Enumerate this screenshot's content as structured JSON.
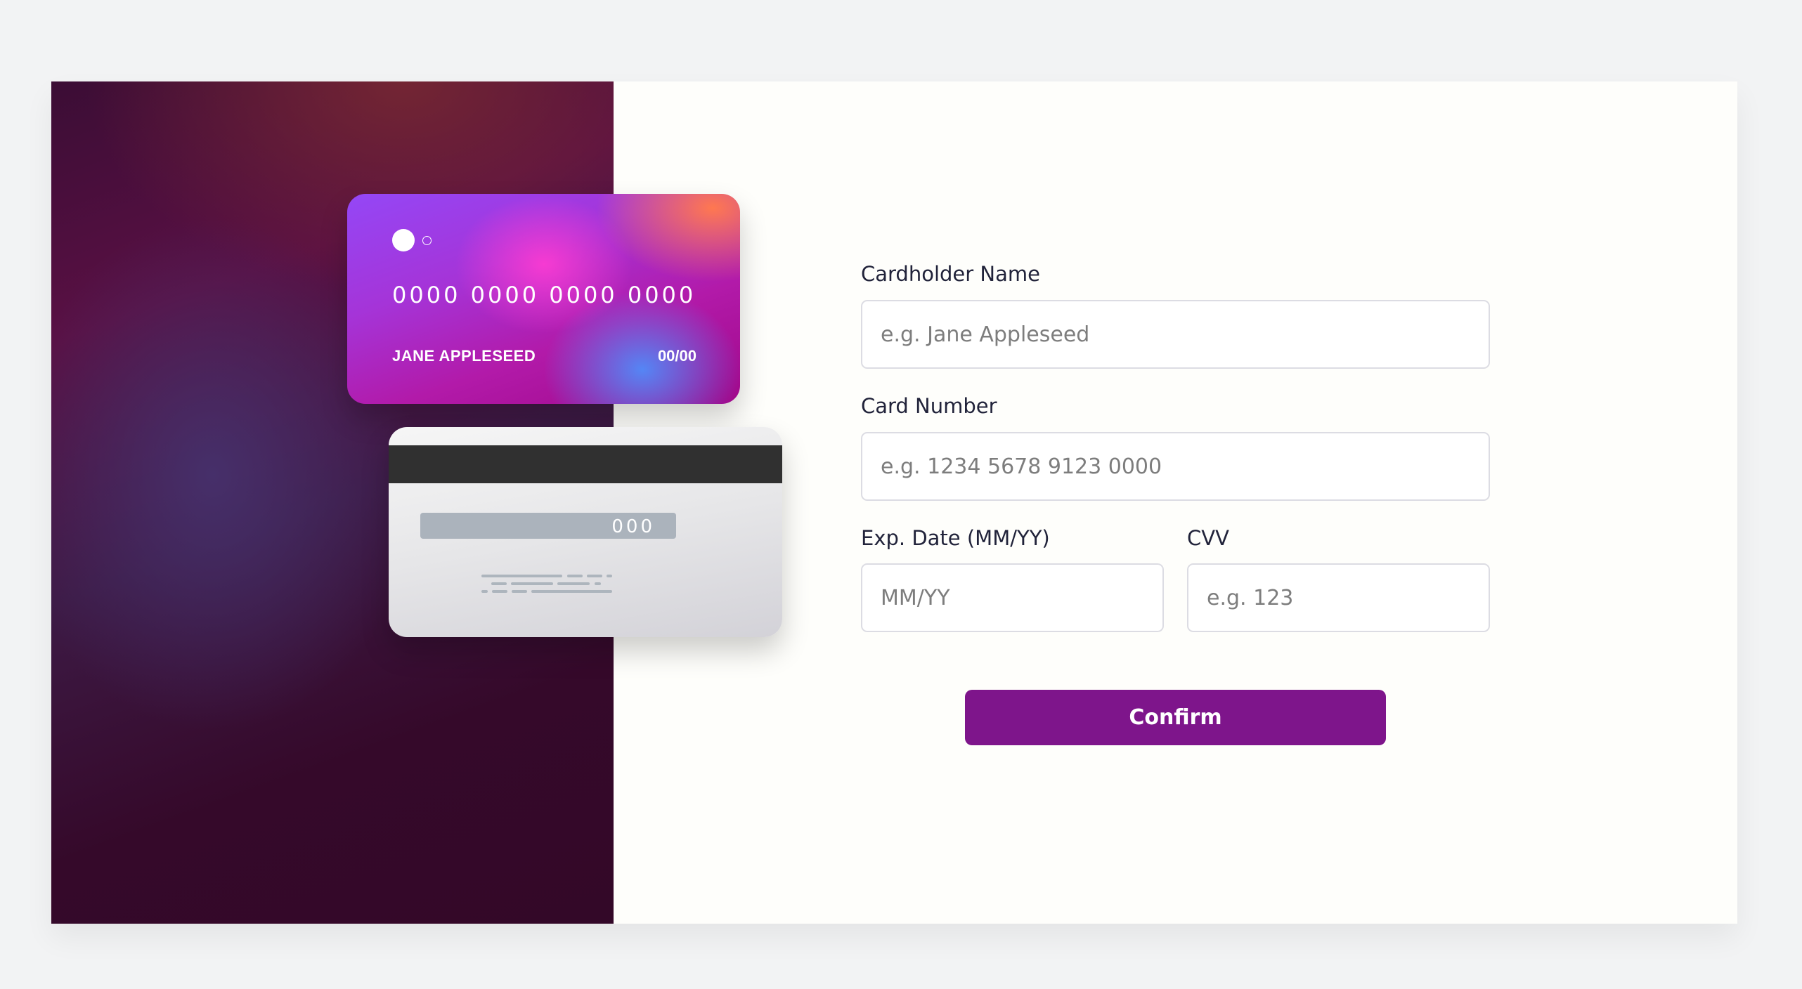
{
  "card_front": {
    "number": "0000 0000 0000 0000",
    "name": "JANE APPLESEED",
    "expiry": "00/00"
  },
  "card_back": {
    "cvv": "000"
  },
  "form": {
    "cardholder_label": "Cardholder Name",
    "cardholder_placeholder": "e.g. Jane Appleseed",
    "number_label": "Card Number",
    "number_placeholder": "e.g. 1234 5678 9123 0000",
    "expiry_label": "Exp. Date (MM/YY)",
    "expiry_placeholder": "MM/YY",
    "cvv_label": "CVV",
    "cvv_placeholder": "e.g. 123",
    "confirm_label": "Confirm"
  },
  "colors": {
    "accent": "#7e158b",
    "label": "#21233a",
    "border": "#dcdce3"
  }
}
